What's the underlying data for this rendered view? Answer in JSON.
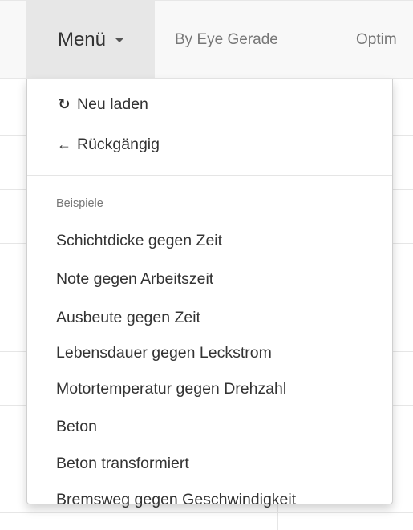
{
  "navbar": {
    "menu_label": "Menü",
    "links": [
      "By Eye Gerade",
      "Optim"
    ]
  },
  "dropdown": {
    "actions": [
      {
        "icon": "refresh-icon",
        "glyph": "↻",
        "label": "Neu laden"
      },
      {
        "icon": "arrow-left-icon",
        "glyph": "←",
        "label": "Rückgängig"
      }
    ],
    "section_header": "Beispiele",
    "examples": [
      "Schichtdicke gegen Zeit",
      "Note gegen Arbeitszeit",
      "Ausbeute gegen Zeit",
      "Lebensdauer gegen Leckstrom",
      "Motortemperatur gegen Drehzahl",
      "Beton",
      "Beton transformiert",
      "Bremsweg gegen Geschwindigkeit"
    ]
  }
}
